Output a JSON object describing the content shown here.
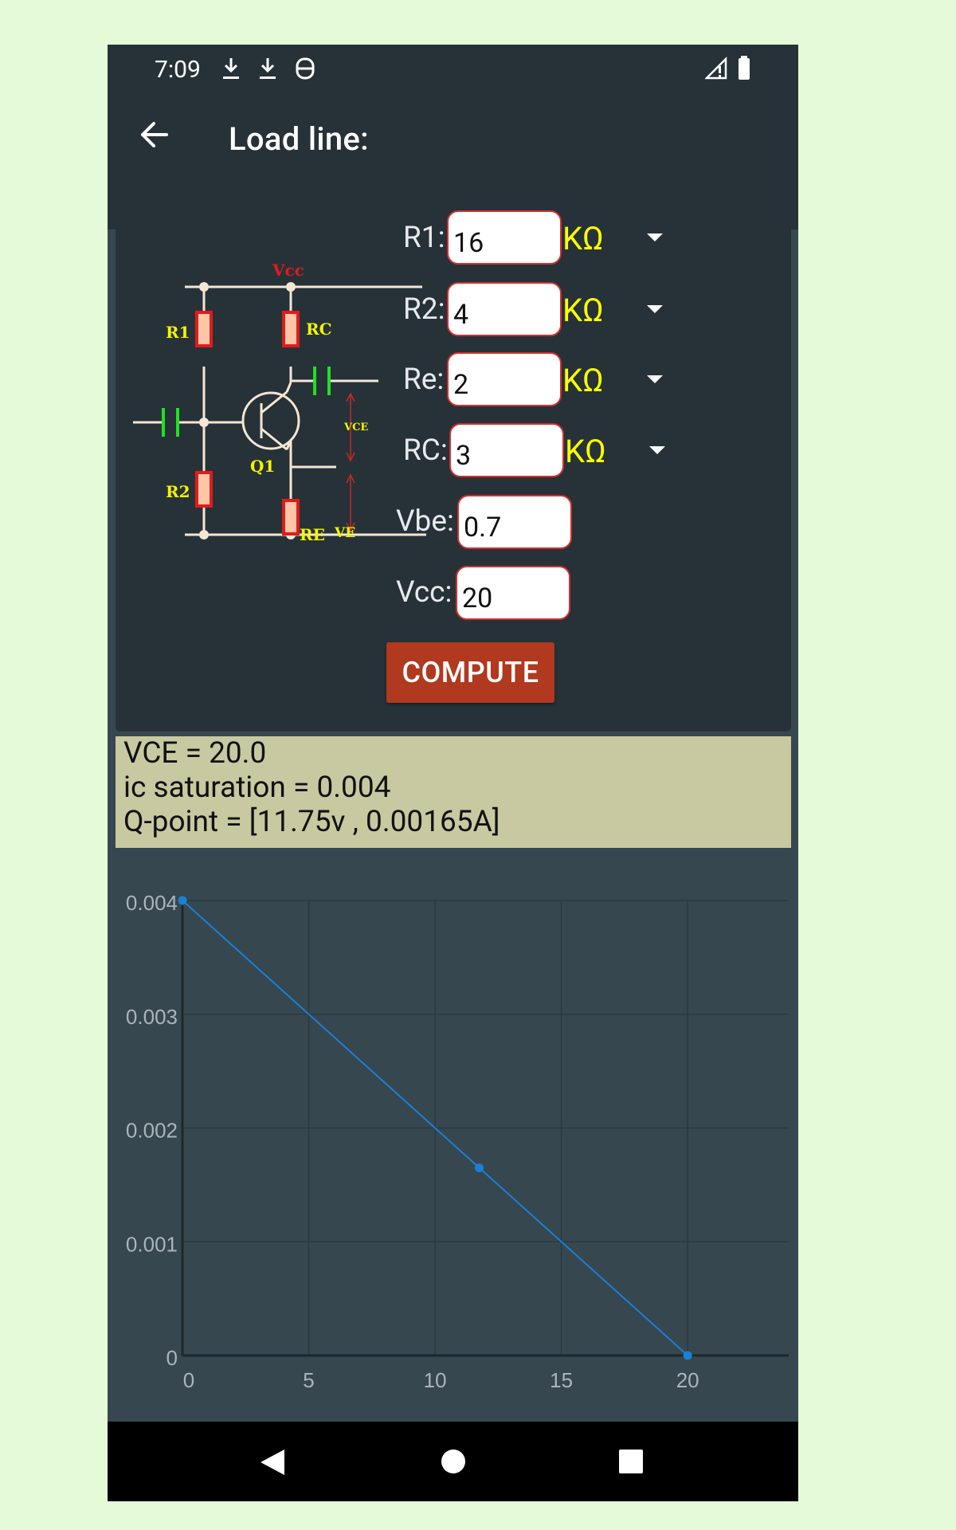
{
  "status_bar": {
    "time": "7:09"
  },
  "app_bar": {
    "title": "Load line:"
  },
  "circuit": {
    "labels": {
      "vcc": "Vcc",
      "r1": "R1",
      "r2": "R2",
      "rc": "RC",
      "re": "RE",
      "q1": "Q1",
      "vce": "VCE",
      "ve": "VE"
    }
  },
  "inputs": {
    "r1": {
      "label": "R1:",
      "value": "16",
      "unit": "KΩ"
    },
    "r2": {
      "label": "R2:",
      "value": "4",
      "unit": "KΩ"
    },
    "re": {
      "label": "Re:",
      "value": "2",
      "unit": "KΩ"
    },
    "rc": {
      "label": "RC:",
      "value": "3",
      "unit": "KΩ"
    },
    "vbe": {
      "label": "Vbe:",
      "value": "0.7"
    },
    "vcc": {
      "label": "Vcc:",
      "value": "20"
    }
  },
  "compute_label": "COMPUTE",
  "results": {
    "line1": "VCE = 20.0",
    "line2": "ic saturation = 0.004",
    "line3": "Q-point = [11.75v , 0.00165A]"
  },
  "colors": {
    "accent_button": "#b0391f",
    "unit_text": "#ffff00",
    "series_line": "#1a7fd6",
    "result_bg": "#c8c9a1"
  },
  "chart_data": {
    "type": "line",
    "series": [
      {
        "x": [
          0,
          11.75,
          20
        ],
        "y": [
          0.004,
          0.00165,
          0
        ]
      }
    ],
    "xlim": [
      0,
      24
    ],
    "ylim": [
      0,
      0.004
    ],
    "xticks": [
      "0",
      "5",
      "10",
      "15",
      "20"
    ],
    "xtick_values": [
      0,
      5,
      10,
      15,
      20
    ],
    "yticks": [
      "0",
      "0.001",
      "0.002",
      "0.003",
      "0.004"
    ],
    "ytick_values": [
      0,
      0.001,
      0.002,
      0.003,
      0.004
    ],
    "grid": true
  }
}
